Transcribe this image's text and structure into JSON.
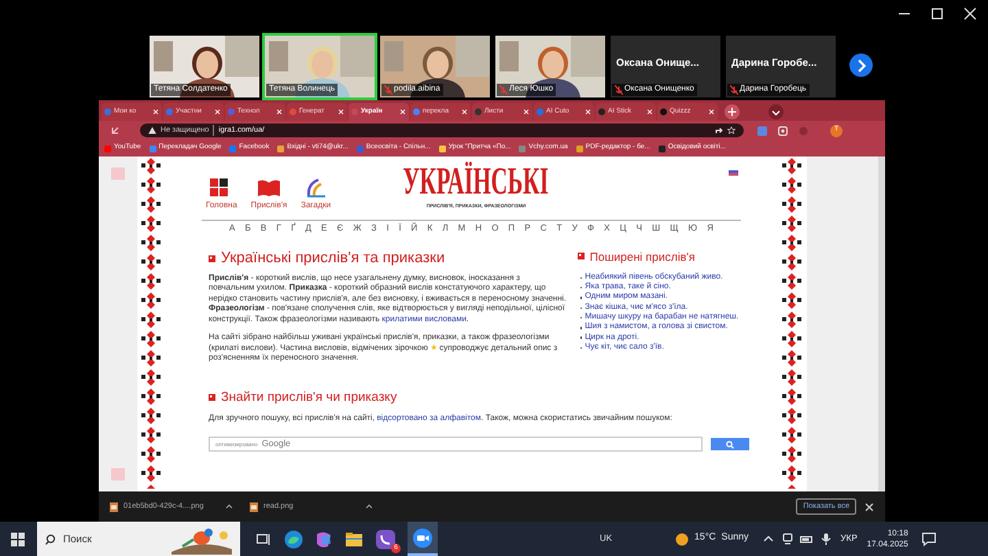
{
  "meeting": {
    "participants": [
      {
        "kind": "video",
        "name": "Тетяна Солдатенко",
        "muted": false,
        "speaking": false
      },
      {
        "kind": "video",
        "name": "Тетяна Волинець",
        "muted": false,
        "speaking": true
      },
      {
        "kind": "video",
        "name": "podila.aibina",
        "muted": true,
        "speaking": false
      },
      {
        "kind": "video",
        "name": "Леся Юшко",
        "muted": true,
        "speaking": false
      },
      {
        "kind": "name",
        "display": "Оксана Онище...",
        "name": "Оксана Онищенко",
        "muted": true,
        "speaking": false
      },
      {
        "kind": "name",
        "display": "Дарина Горобе...",
        "name": "Дарина Горобець",
        "muted": true,
        "speaking": false
      }
    ]
  },
  "browser": {
    "tabs": [
      {
        "label": "Мои ко",
        "color": "#3b6fe0",
        "selected": false
      },
      {
        "label": "Участни",
        "color": "#3b6fe0",
        "selected": false
      },
      {
        "label": "Технол",
        "color": "#5b5bd6",
        "selected": false
      },
      {
        "label": "Генерат",
        "color": "#e04a3b",
        "selected": false
      },
      {
        "label": "Україн",
        "color": "#c24a58",
        "selected": true
      },
      {
        "label": "перекла",
        "color": "#4285f4",
        "selected": false
      },
      {
        "label": "Листи",
        "color": "#333333",
        "selected": false
      },
      {
        "label": "AI Cuto",
        "color": "#1a73e8",
        "selected": false
      },
      {
        "label": "AI Stick",
        "color": "#222222",
        "selected": false
      },
      {
        "label": "Quizzz",
        "color": "#111111",
        "selected": false
      }
    ],
    "security": "Не защищено",
    "url": "igra1.com/ua/",
    "profile": "T",
    "bookmarks": [
      {
        "label": "YouTube",
        "color": "#ff0000"
      },
      {
        "label": "Перекладач Google",
        "color": "#4285f4"
      },
      {
        "label": "Facebook",
        "color": "#1877f2"
      },
      {
        "label": "Вхідні - vti74@ukr...",
        "color": "#e8a33b"
      },
      {
        "label": "Всеосвіта - Спільн...",
        "color": "#3b5bd6"
      },
      {
        "label": "Урок \"Притча «По...",
        "color": "#f4c542"
      },
      {
        "label": "Vchy.com.ua",
        "color": "#888888"
      },
      {
        "label": "PDF-редактор - бе...",
        "color": "#e0a020"
      },
      {
        "label": "Освідовий освіті...",
        "color": "#222222"
      }
    ]
  },
  "page": {
    "nav": [
      {
        "label": "Головна",
        "kind": "home"
      },
      {
        "label": "Прислів'я",
        "kind": "book"
      },
      {
        "label": "Загадки",
        "kind": "riddle"
      }
    ],
    "logo": "УКРАЇНСЬКІ",
    "tagline": "ПРИСЛІВ'Я, ПРИКАЗКИ, ФРАЗЕОЛОГІЗМИ",
    "alphabet": [
      "А",
      "Б",
      "В",
      "Г",
      "Ґ",
      "Д",
      "Е",
      "Є",
      "Ж",
      "З",
      "І",
      "Ї",
      "Й",
      "К",
      "Л",
      "М",
      "Н",
      "О",
      "П",
      "Р",
      "С",
      "Т",
      "У",
      "Ф",
      "Х",
      "Ц",
      "Ч",
      "Ш",
      "Щ",
      "Ю",
      "Я"
    ],
    "heading": "Українські прислів'я та приказки",
    "intro": {
      "text": "**Прислів'я** - короткий вислів, що несе узагальнену думку, висновок, іносказання з повчальним ухилом. **Приказка** - короткий образний вислів констатуючого характеру, що нерідко становить частину прислів'я, але без висновку, і вживається в переносному значенні. **Фразеологізм** - пов'язане сполучення слів, яке відтворюється у вигляді неподільної, цілісної конструкції. Також фразеологізми називають ",
      "link": "крилатими висловами",
      "end": "."
    },
    "about": {
      "before": "На сайті зібрано найбільш уживані українські прислів'я, приказки, а також фразеологізми (крилаті вислови). Частина висловів, відмічених зірочкою",
      "star": "★",
      "after": "супроводжує детальний опис з роз'ясненням їх переносного значення."
    },
    "search_heading": "Знайти прислів'я чи приказку",
    "search_text": {
      "before": "Для зручного пошуку, всі прислів'я на сайті,",
      "link": "відсортовано за алфавітом",
      "after": ". Також, можна скористатись звичайним пошуком:"
    },
    "search": {
      "note": "оптимизировано",
      "brand": "Google"
    },
    "popular": {
      "title": "Поширені прислів'я",
      "items": [
        "Неабиякий півень обскубаний живо.",
        "Яка трава, таке й сіно.",
        "Одним миром мазані.",
        "Знає кішка, чиє м'ясо з'їла.",
        "Мишачу шкуру на барабан не натягнеш.",
        "Шия з намистом, а голова зі свистом.",
        "Цирк на дроті.",
        "Чує кіт, чиє сало з'їв."
      ]
    }
  },
  "downloads": {
    "files": [
      "01eb5bd0-429c-4....png",
      "read.png"
    ],
    "show_all": "Показать все"
  },
  "taskbar": {
    "search": "Поиск",
    "badge": "6",
    "center": "UK",
    "temperature": "15°C",
    "weather": "Sunny",
    "language": "УКР",
    "time": "10:18",
    "date": "17.04.2025"
  }
}
